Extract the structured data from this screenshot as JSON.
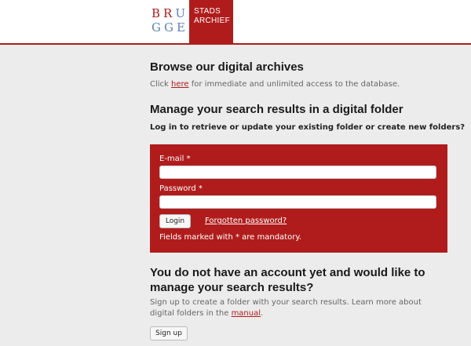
{
  "header": {
    "logo_line1": "BRU",
    "logo_line2": "GGE",
    "box_line1": "STADS",
    "box_line2": "ARCHIEF",
    "accent_color": "#b01c1c"
  },
  "browse": {
    "title": "Browse our digital archives",
    "text_prefix": "Click ",
    "link": "here",
    "text_suffix": " for immediate and unlimited access to the database."
  },
  "manage": {
    "title": "Manage your search results in a digital folder",
    "subtitle": "Log in to retrieve or update your existing folder or create new folders?"
  },
  "login_form": {
    "email_label": "E-mail",
    "password_label": "Password",
    "required_marker": "*",
    "email_value": "",
    "password_value": "",
    "login_button": "Login",
    "forgot_link": "Forgotten password?",
    "mandatory_prefix": "Fields marked with ",
    "mandatory_suffix": " are mandatory."
  },
  "signup": {
    "title": "You do not have an account yet and would like to manage your search results?",
    "text": "Sign up to create a folder with your search results. Learn more about digital folders in the ",
    "link": "manual",
    "text_end": ".",
    "button": "Sign up"
  }
}
